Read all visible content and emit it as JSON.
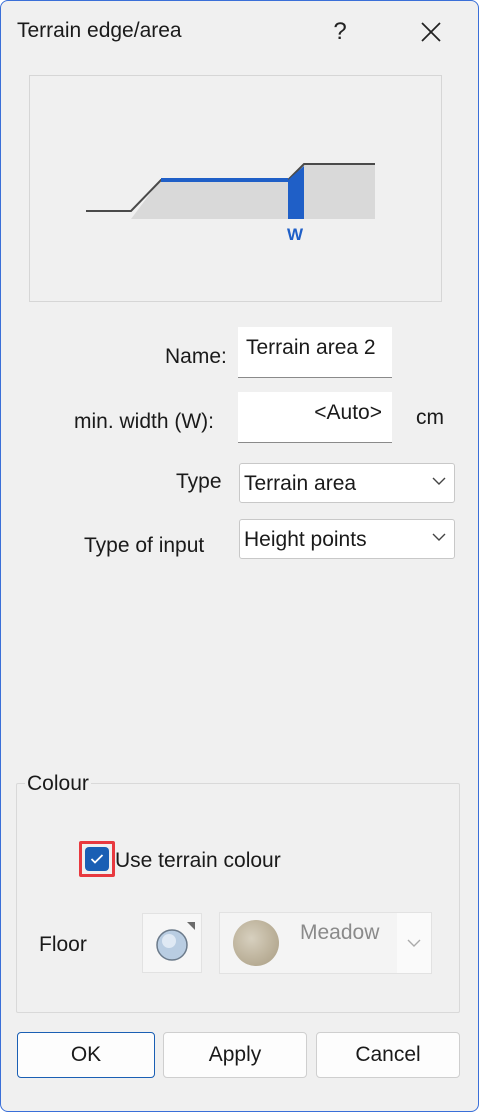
{
  "window": {
    "title": "Terrain edge/area",
    "help_label": "?"
  },
  "preview": {
    "width_marker": "W",
    "accent_color": "#1f5fc7"
  },
  "fields": {
    "name_label": "Name:",
    "name_value": "Terrain area 2",
    "min_width_label": "min. width (W):",
    "min_width_value": "<Auto>",
    "min_width_unit": "cm",
    "type_label": "Type",
    "type_value": "Terrain area",
    "input_type_label": "Type of input",
    "input_type_value": "Height points"
  },
  "colour_group": {
    "title": "Colour",
    "use_terrain_colour_label": "Use terrain colour",
    "use_terrain_colour_checked": true,
    "floor_label": "Floor",
    "floor_value": "Meadow"
  },
  "buttons": {
    "ok": "OK",
    "apply": "Apply",
    "cancel": "Cancel"
  },
  "colors": {
    "accent": "#1a5fb4",
    "highlight": "#e8393f",
    "window_border": "#3a6fd8"
  }
}
